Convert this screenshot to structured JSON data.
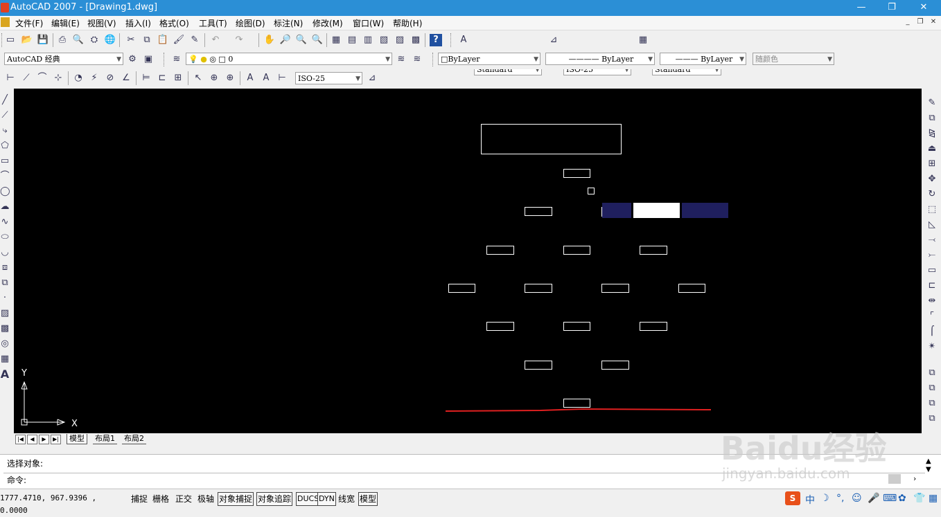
{
  "app": {
    "title": "AutoCAD 2007 - [Drawing1.dwg]",
    "minimize_glyph": "—",
    "restore_glyph": "❐",
    "close_glyph": "✕"
  },
  "menu": [
    "文件(F)",
    "编辑(E)",
    "视图(V)",
    "插入(I)",
    "格式(O)",
    "工具(T)",
    "绘图(D)",
    "标注(N)",
    "修改(M)",
    "窗口(W)",
    "帮助(H)"
  ],
  "styles_toolbar": {
    "text_style": "Standard",
    "dim_style": "ISO-25",
    "table_style": "Standard"
  },
  "workspace": "AutoCAD 经典",
  "layer": {
    "current": "0"
  },
  "properties": {
    "color": "ByLayer",
    "linetype": "ByLayer",
    "lineweight": "ByLayer",
    "plotstyle": "随颜色"
  },
  "dim_toolbar": {
    "dim_style": "ISO-25"
  },
  "ucs": {
    "x_label": "X",
    "y_label": "Y"
  },
  "tabs": [
    "模型",
    "布局1",
    "布局2"
  ],
  "tab_nav": [
    "|◀",
    "◀",
    "▶",
    "▶|"
  ],
  "command": {
    "history": "选择对象:",
    "prompt": "命令:"
  },
  "status": {
    "coords": "1777.4710, 967.9396 , 0.0000",
    "toggles": [
      "捕捉",
      "栅格",
      "正交",
      "极轴",
      "对象捕捉",
      "对象追踪",
      "DUCS",
      "DYN",
      "线宽",
      "模型"
    ]
  },
  "ime": {
    "label": "中"
  },
  "watermark": {
    "text": "Baidu经验",
    "url": "jingyan.baidu.com"
  },
  "colors": {
    "titlebar": "#2b8fd6",
    "canvas": "#000000",
    "entity": "#ffffff",
    "highlight_dark": "#1f1f5e",
    "highlight_white": "#ffffff",
    "annotation_line": "#e02020"
  }
}
